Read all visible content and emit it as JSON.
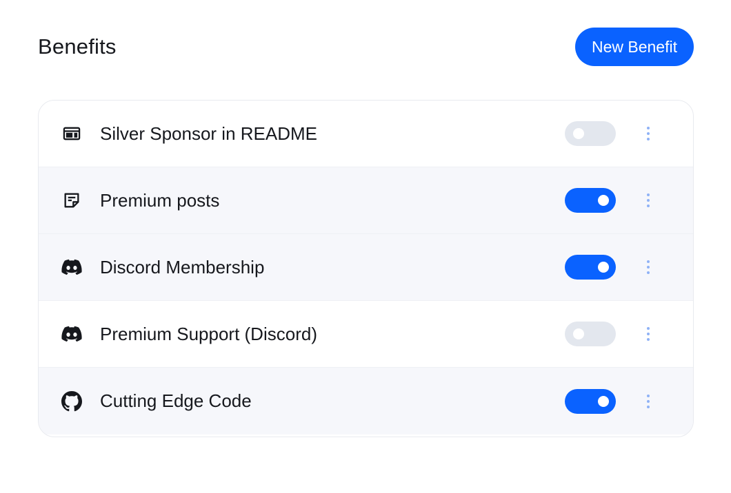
{
  "header": {
    "title": "Benefits",
    "new_button_label": "New Benefit"
  },
  "benefits": [
    {
      "label": "Silver Sponsor in README",
      "icon": "ad-card-icon",
      "enabled": false
    },
    {
      "label": "Premium posts",
      "icon": "article-note-icon",
      "enabled": true
    },
    {
      "label": "Discord Membership",
      "icon": "discord-icon",
      "enabled": true
    },
    {
      "label": "Premium Support (Discord)",
      "icon": "discord-icon",
      "enabled": false
    },
    {
      "label": "Cutting Edge Code",
      "icon": "github-icon",
      "enabled": true
    }
  ],
  "colors": {
    "accent": "#0a62ff",
    "toggle_off": "#e3e7ee",
    "menu_dots": "#8fb2f6",
    "alt_row": "#f6f7fb"
  }
}
